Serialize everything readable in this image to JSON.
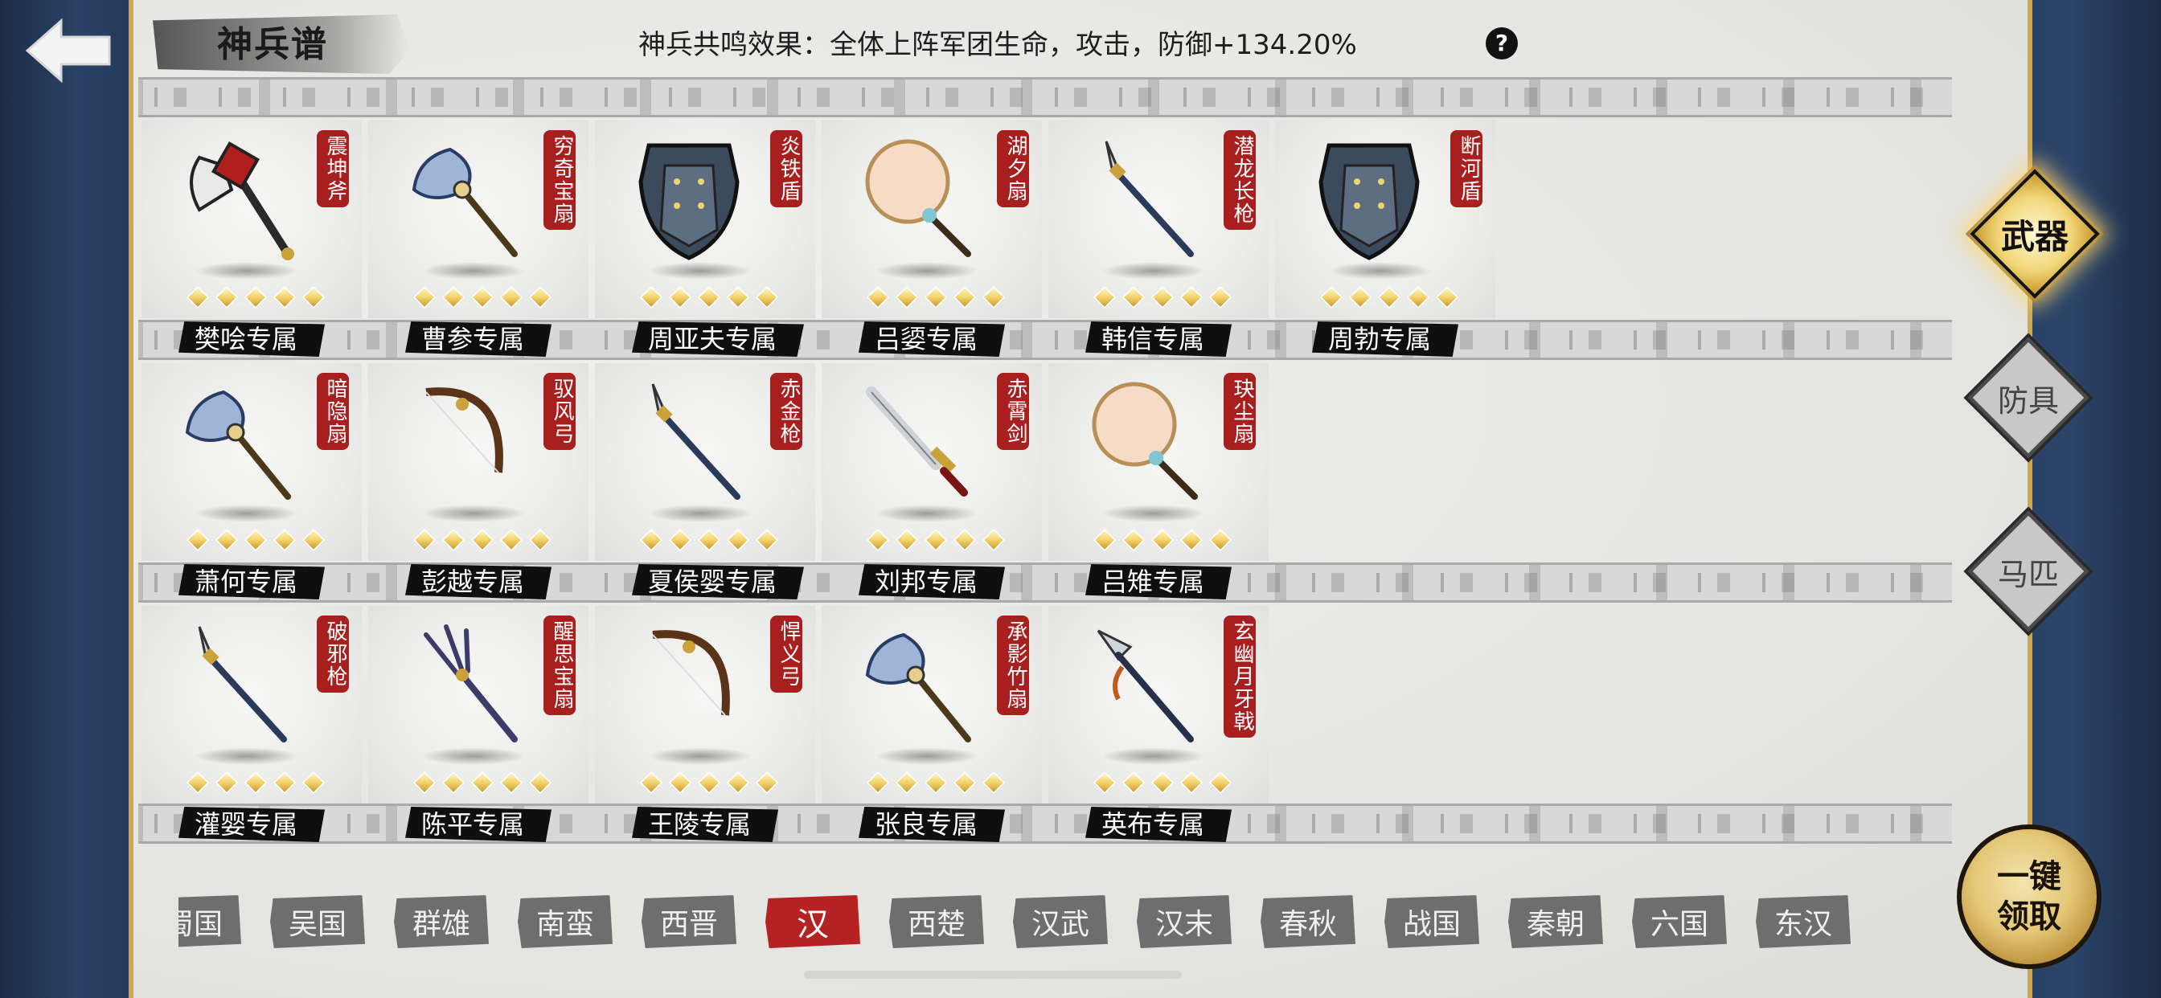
{
  "header": {
    "title": "神兵谱",
    "resonance_text": "神兵共鸣效果：全体上阵军团生命，攻击，防御+134.20%",
    "help_icon": "?"
  },
  "colors": {
    "name_tag_red": "#a81f1f",
    "active_nation_red": "#b42222",
    "gold_accent": "#e4c777",
    "navy_band": "#2a4266"
  },
  "weapons": [
    {
      "name": "震坤斧",
      "owner": "樊哙专属",
      "stars": 5,
      "icon": "axe-icon"
    },
    {
      "name": "穷奇宝扇",
      "owner": "曹参专属",
      "stars": 5,
      "icon": "feather-fan-icon"
    },
    {
      "name": "炎铁盾",
      "owner": "周亚夫专属",
      "stars": 5,
      "icon": "shield-icon"
    },
    {
      "name": "湖夕扇",
      "owner": "吕媭专属",
      "stars": 5,
      "icon": "round-fan-icon"
    },
    {
      "name": "潜龙长枪",
      "owner": "韩信专属",
      "stars": 5,
      "icon": "spear-icon"
    },
    {
      "name": "断河盾",
      "owner": "周勃专属",
      "stars": 5,
      "icon": "shield-icon"
    },
    {
      "name": "暗隐扇",
      "owner": "萧何专属",
      "stars": 5,
      "icon": "feather-fan-icon"
    },
    {
      "name": "驭风弓",
      "owner": "彭越专属",
      "stars": 5,
      "icon": "bow-icon"
    },
    {
      "name": "赤金枪",
      "owner": "夏侯婴专属",
      "stars": 5,
      "icon": "spear-icon"
    },
    {
      "name": "赤霄剑",
      "owner": "刘邦专属",
      "stars": 5,
      "icon": "sword-icon"
    },
    {
      "name": "玦尘扇",
      "owner": "吕雉专属",
      "stars": 5,
      "icon": "round-fan-icon"
    },
    {
      "name": "破邪枪",
      "owner": "灌婴专属",
      "stars": 5,
      "icon": "spear-icon"
    },
    {
      "name": "醒思宝扇",
      "owner": "陈平专属",
      "stars": 5,
      "icon": "trident-fan-icon"
    },
    {
      "name": "悍义弓",
      "owner": "王陵专属",
      "stars": 5,
      "icon": "bow-icon"
    },
    {
      "name": "承影竹扇",
      "owner": "张良专属",
      "stars": 5,
      "icon": "feather-fan-icon"
    },
    {
      "name": "玄幽月牙戟",
      "owner": "英布专属",
      "stars": 5,
      "icon": "halberd-icon"
    }
  ],
  "categories": [
    {
      "label": "武器",
      "active": true
    },
    {
      "label": "防具",
      "active": false
    },
    {
      "label": "马匹",
      "active": false
    }
  ],
  "claim_button": {
    "line1": "一键",
    "line2": "领取"
  },
  "nations": [
    {
      "label": "蜀国",
      "active": false
    },
    {
      "label": "吴国",
      "active": false
    },
    {
      "label": "群雄",
      "active": false
    },
    {
      "label": "南蛮",
      "active": false
    },
    {
      "label": "西晋",
      "active": false
    },
    {
      "label": "汉",
      "active": true
    },
    {
      "label": "西楚",
      "active": false
    },
    {
      "label": "汉武",
      "active": false
    },
    {
      "label": "汉末",
      "active": false
    },
    {
      "label": "春秋",
      "active": false
    },
    {
      "label": "战国",
      "active": false
    },
    {
      "label": "秦朝",
      "active": false
    },
    {
      "label": "六国",
      "active": false
    },
    {
      "label": "东汉",
      "active": false
    }
  ]
}
